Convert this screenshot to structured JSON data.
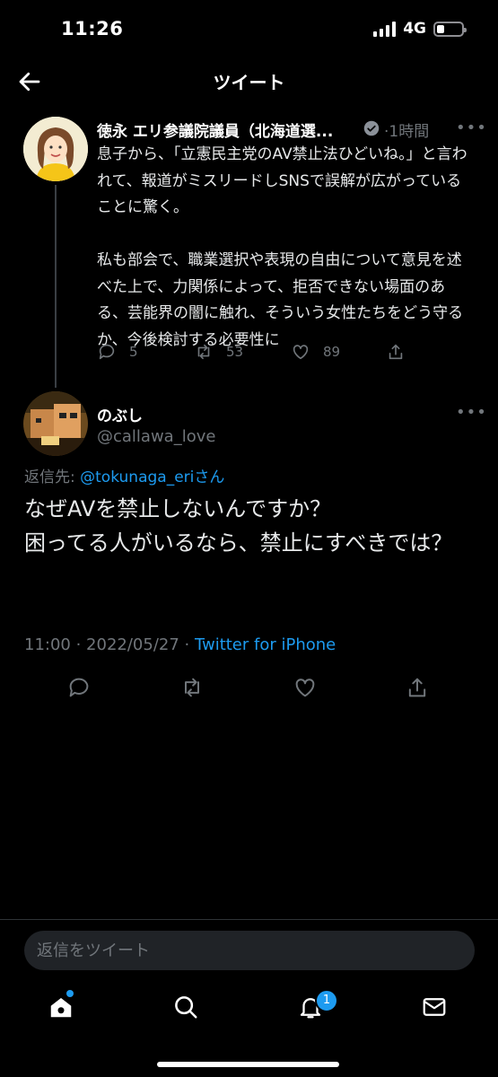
{
  "status_bar": {
    "time": "11:26",
    "network": "4G"
  },
  "header": {
    "title": "ツイート"
  },
  "parent_tweet": {
    "name": "徳永 エリ参議院議員（北海道選...",
    "time": "·1時間",
    "text": "息子から、「立憲民主党のAV禁止法ひどいね。」と言われて、報道がミスリードしSNSで誤解が広がっていることに驚く。\n\n私も部会で、職業選択や表現の自由について意見を述べた上で、力関係によって、拒否できない場面のある、芸能界の闇に触れ、そういう女性たちをどう守るか、今後検討する必要性に",
    "replies": "5",
    "retweets": "53",
    "likes": "89"
  },
  "reply_tweet": {
    "name": "のぶし",
    "handle": "@callawa_love",
    "replying_label": "返信先: ",
    "replying_mention": "@tokunaga_eri",
    "replying_suffix": "さん",
    "text": "なぜAVを禁止しないんですか？\n困ってる人がいるなら、禁止にすべきでは？",
    "timestamp": "11:00 · 2022/05/27 · ",
    "source": "Twitter for iPhone"
  },
  "compose": {
    "placeholder": "返信をツイート"
  },
  "nav": {
    "notification_count": "1"
  },
  "colors": {
    "accent": "#1d9bf0",
    "background": "#000000",
    "muted": "#71767b"
  }
}
